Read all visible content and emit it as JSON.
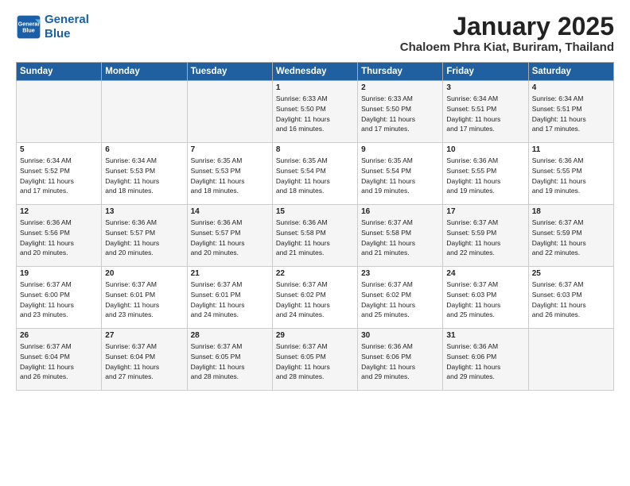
{
  "header": {
    "logo_line1": "General",
    "logo_line2": "Blue",
    "title": "January 2025",
    "subtitle": "Chaloem Phra Kiat, Buriram, Thailand"
  },
  "weekdays": [
    "Sunday",
    "Monday",
    "Tuesday",
    "Wednesday",
    "Thursday",
    "Friday",
    "Saturday"
  ],
  "weeks": [
    [
      {
        "day": "",
        "info": ""
      },
      {
        "day": "",
        "info": ""
      },
      {
        "day": "",
        "info": ""
      },
      {
        "day": "1",
        "info": "Sunrise: 6:33 AM\nSunset: 5:50 PM\nDaylight: 11 hours\nand 16 minutes."
      },
      {
        "day": "2",
        "info": "Sunrise: 6:33 AM\nSunset: 5:50 PM\nDaylight: 11 hours\nand 17 minutes."
      },
      {
        "day": "3",
        "info": "Sunrise: 6:34 AM\nSunset: 5:51 PM\nDaylight: 11 hours\nand 17 minutes."
      },
      {
        "day": "4",
        "info": "Sunrise: 6:34 AM\nSunset: 5:51 PM\nDaylight: 11 hours\nand 17 minutes."
      }
    ],
    [
      {
        "day": "5",
        "info": "Sunrise: 6:34 AM\nSunset: 5:52 PM\nDaylight: 11 hours\nand 17 minutes."
      },
      {
        "day": "6",
        "info": "Sunrise: 6:34 AM\nSunset: 5:53 PM\nDaylight: 11 hours\nand 18 minutes."
      },
      {
        "day": "7",
        "info": "Sunrise: 6:35 AM\nSunset: 5:53 PM\nDaylight: 11 hours\nand 18 minutes."
      },
      {
        "day": "8",
        "info": "Sunrise: 6:35 AM\nSunset: 5:54 PM\nDaylight: 11 hours\nand 18 minutes."
      },
      {
        "day": "9",
        "info": "Sunrise: 6:35 AM\nSunset: 5:54 PM\nDaylight: 11 hours\nand 19 minutes."
      },
      {
        "day": "10",
        "info": "Sunrise: 6:36 AM\nSunset: 5:55 PM\nDaylight: 11 hours\nand 19 minutes."
      },
      {
        "day": "11",
        "info": "Sunrise: 6:36 AM\nSunset: 5:55 PM\nDaylight: 11 hours\nand 19 minutes."
      }
    ],
    [
      {
        "day": "12",
        "info": "Sunrise: 6:36 AM\nSunset: 5:56 PM\nDaylight: 11 hours\nand 20 minutes."
      },
      {
        "day": "13",
        "info": "Sunrise: 6:36 AM\nSunset: 5:57 PM\nDaylight: 11 hours\nand 20 minutes."
      },
      {
        "day": "14",
        "info": "Sunrise: 6:36 AM\nSunset: 5:57 PM\nDaylight: 11 hours\nand 20 minutes."
      },
      {
        "day": "15",
        "info": "Sunrise: 6:36 AM\nSunset: 5:58 PM\nDaylight: 11 hours\nand 21 minutes."
      },
      {
        "day": "16",
        "info": "Sunrise: 6:37 AM\nSunset: 5:58 PM\nDaylight: 11 hours\nand 21 minutes."
      },
      {
        "day": "17",
        "info": "Sunrise: 6:37 AM\nSunset: 5:59 PM\nDaylight: 11 hours\nand 22 minutes."
      },
      {
        "day": "18",
        "info": "Sunrise: 6:37 AM\nSunset: 5:59 PM\nDaylight: 11 hours\nand 22 minutes."
      }
    ],
    [
      {
        "day": "19",
        "info": "Sunrise: 6:37 AM\nSunset: 6:00 PM\nDaylight: 11 hours\nand 23 minutes."
      },
      {
        "day": "20",
        "info": "Sunrise: 6:37 AM\nSunset: 6:01 PM\nDaylight: 11 hours\nand 23 minutes."
      },
      {
        "day": "21",
        "info": "Sunrise: 6:37 AM\nSunset: 6:01 PM\nDaylight: 11 hours\nand 24 minutes."
      },
      {
        "day": "22",
        "info": "Sunrise: 6:37 AM\nSunset: 6:02 PM\nDaylight: 11 hours\nand 24 minutes."
      },
      {
        "day": "23",
        "info": "Sunrise: 6:37 AM\nSunset: 6:02 PM\nDaylight: 11 hours\nand 25 minutes."
      },
      {
        "day": "24",
        "info": "Sunrise: 6:37 AM\nSunset: 6:03 PM\nDaylight: 11 hours\nand 25 minutes."
      },
      {
        "day": "25",
        "info": "Sunrise: 6:37 AM\nSunset: 6:03 PM\nDaylight: 11 hours\nand 26 minutes."
      }
    ],
    [
      {
        "day": "26",
        "info": "Sunrise: 6:37 AM\nSunset: 6:04 PM\nDaylight: 11 hours\nand 26 minutes."
      },
      {
        "day": "27",
        "info": "Sunrise: 6:37 AM\nSunset: 6:04 PM\nDaylight: 11 hours\nand 27 minutes."
      },
      {
        "day": "28",
        "info": "Sunrise: 6:37 AM\nSunset: 6:05 PM\nDaylight: 11 hours\nand 28 minutes."
      },
      {
        "day": "29",
        "info": "Sunrise: 6:37 AM\nSunset: 6:05 PM\nDaylight: 11 hours\nand 28 minutes."
      },
      {
        "day": "30",
        "info": "Sunrise: 6:36 AM\nSunset: 6:06 PM\nDaylight: 11 hours\nand 29 minutes."
      },
      {
        "day": "31",
        "info": "Sunrise: 6:36 AM\nSunset: 6:06 PM\nDaylight: 11 hours\nand 29 minutes."
      },
      {
        "day": "",
        "info": ""
      }
    ]
  ]
}
